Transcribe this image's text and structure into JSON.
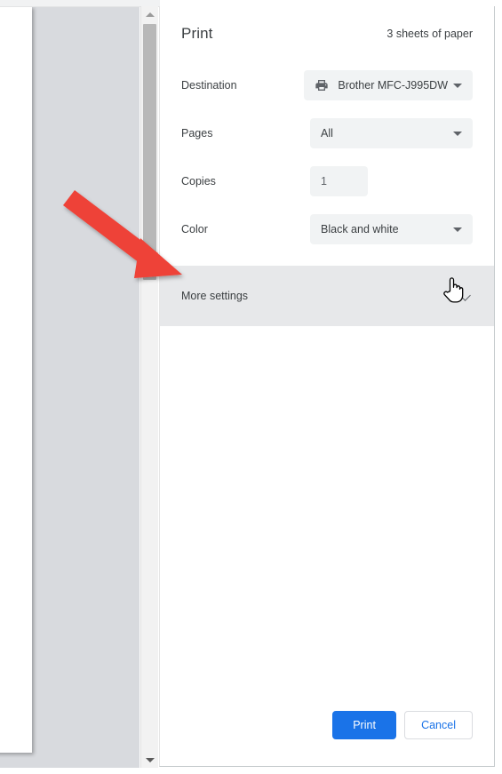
{
  "dialog": {
    "title": "Print",
    "sheets_summary": "3 sheets of paper",
    "rows": [
      {
        "label": "Destination",
        "value": "Brother MFC-J995DW",
        "type": "select",
        "icon": "printer-icon"
      },
      {
        "label": "Pages",
        "value": "All",
        "type": "select"
      },
      {
        "label": "Copies",
        "value": "1",
        "type": "number-input"
      },
      {
        "label": "Color",
        "value": "Black and white",
        "type": "select"
      }
    ],
    "more_settings": {
      "label": "More settings",
      "expand_icon": "chevron-down-icon"
    },
    "footer": {
      "print_label": "Print",
      "cancel_label": "Cancel"
    }
  },
  "preview": {
    "scrollbar": {
      "up_icon": "scroll-up-arrow-icon",
      "down_icon": "scroll-down-arrow-icon"
    }
  },
  "annotation": {
    "arrow_color": "#ee4338",
    "points_to": "More settings"
  },
  "cursor": {
    "type": "pointing-hand-cursor"
  },
  "colors": {
    "accent_blue": "#1a73e8",
    "control_bg": "#f1f3f4",
    "more_settings_bg": "#e7e8ea",
    "preview_bg": "#d8dade",
    "text_primary": "#3c4043",
    "annotation_red": "#ee4338"
  }
}
